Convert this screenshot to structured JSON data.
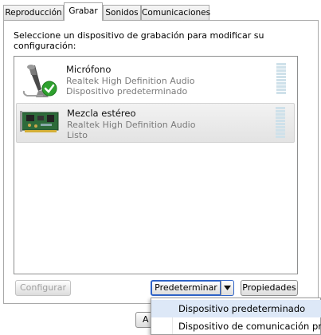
{
  "tabs": [
    {
      "label": "Reproducción"
    },
    {
      "label": "Grabar"
    },
    {
      "label": "Sonidos"
    },
    {
      "label": "Comunicaciones"
    }
  ],
  "instruction": "Seleccione un dispositivo de grabación para modificar su configuración:",
  "devices": [
    {
      "name": "Micrófono",
      "driver": "Realtek High Definition Audio",
      "status": "Dispositivo predeterminado",
      "icon": "microphone-icon",
      "selected": false
    },
    {
      "name": "Mezcla estéreo",
      "driver": "Realtek High Definition Audio",
      "status": "Listo",
      "icon": "sound-card-icon",
      "selected": true
    }
  ],
  "buttons": {
    "configure": "Configurar",
    "set_default": "Predeterminar",
    "properties": "Propiedades",
    "hidden_left": "A"
  },
  "dropdown_menu": [
    {
      "label": "Dispositivo predeterminado"
    },
    {
      "label": "Dispositivo de comunicación pred"
    }
  ],
  "colors": {
    "accent": "#2f63c7",
    "default_check": "#2ea12e",
    "meter": "#cfe1ea"
  }
}
